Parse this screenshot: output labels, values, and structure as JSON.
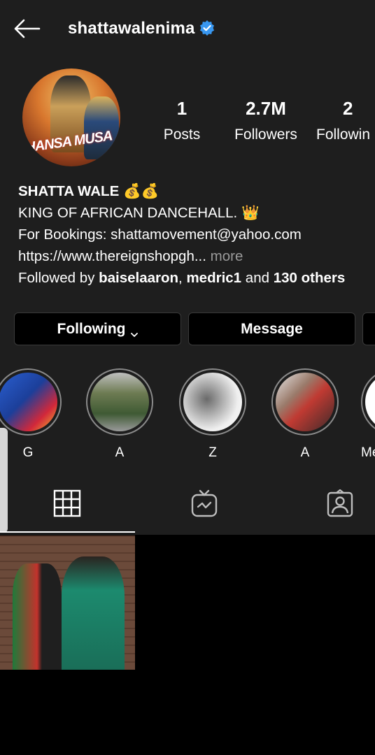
{
  "header": {
    "username": "shattawalenima"
  },
  "stats": [
    {
      "value": "1",
      "label": "Posts"
    },
    {
      "value": "2.7M",
      "label": "Followers"
    },
    {
      "value": "2",
      "label": "Followin"
    }
  ],
  "avatar": {
    "text": "HANSA MUSA"
  },
  "bio": {
    "name": "SHATTA WALE",
    "name_emoji": "💰💰",
    "line1": "KING OF AFRICAN DANCEHALL.",
    "line1_emoji": "👑",
    "line2": "For Bookings: shattamovement@yahoo.com",
    "link": "https://www.thereignshopgh...",
    "more": "more",
    "followed_prefix": "Followed by ",
    "followed_user1": "baiselaaron",
    "followed_sep": ", ",
    "followed_user2": "medric1",
    "followed_and": " and ",
    "followed_others": "130 others"
  },
  "buttons": {
    "following": "Following",
    "message": "Message"
  },
  "highlights": [
    {
      "label": "G"
    },
    {
      "label": "A"
    },
    {
      "label": "Z"
    },
    {
      "label": "A"
    },
    {
      "label": "Me"
    }
  ],
  "colors": {
    "background_top": "#1e1e1e",
    "background_bottom": "#000000",
    "verified": "#3897f0",
    "muted": "#9a9a9a"
  }
}
